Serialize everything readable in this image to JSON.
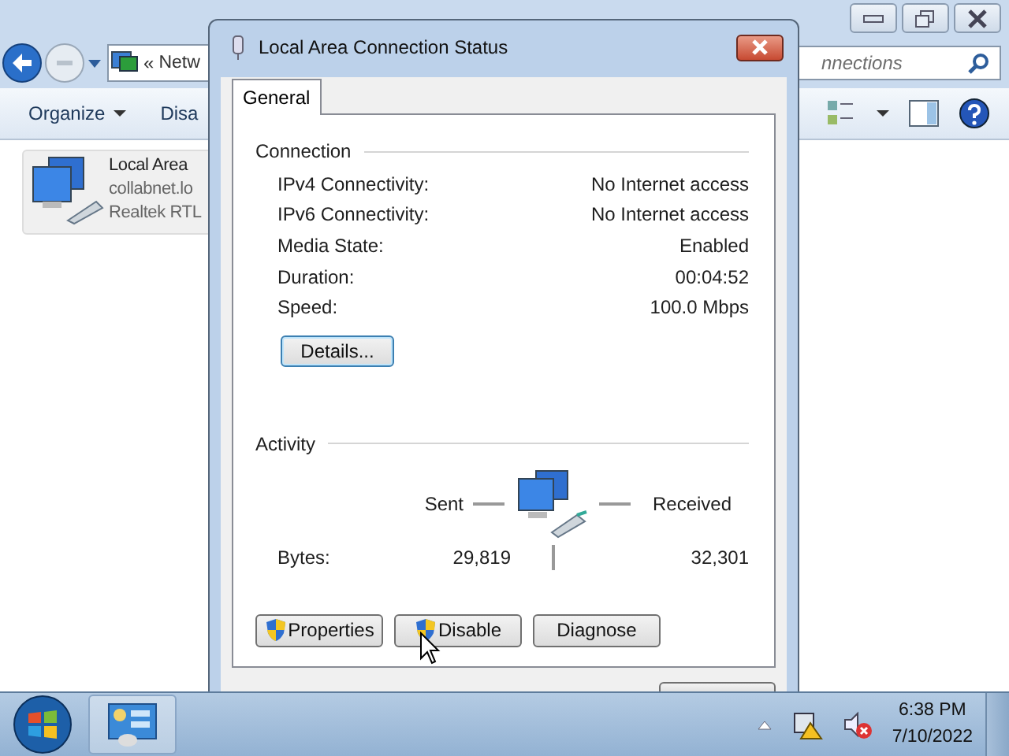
{
  "explorer": {
    "address": {
      "prefix": "«",
      "text": "Netw"
    },
    "search": {
      "placeholder": "nnections"
    },
    "toolbar": [
      {
        "label": "Organize",
        "dropdown": true
      },
      {
        "label": "Disa",
        "dropdown": false
      }
    ],
    "items": [
      {
        "lines": [
          "Local Area",
          "collabnet.lo",
          "Realtek RTL"
        ]
      }
    ]
  },
  "dialog": {
    "title": "Local Area Connection Status",
    "tabs": [
      {
        "label": "General",
        "selected": true
      }
    ],
    "connection": {
      "heading": "Connection",
      "rows": [
        {
          "label": "IPv4 Connectivity:",
          "value": "No Internet access"
        },
        {
          "label": "IPv6 Connectivity:",
          "value": "No Internet access"
        },
        {
          "label": "Media State:",
          "value": "Enabled"
        },
        {
          "label": "Duration:",
          "value": "00:04:52"
        },
        {
          "label": "Speed:",
          "value": "100.0 Mbps"
        }
      ],
      "details_button": "Details..."
    },
    "activity": {
      "heading": "Activity",
      "sent": "Sent",
      "received": "Received",
      "bytes_label": "Bytes:",
      "bytes_sent": "29,819",
      "bytes_received": "32,301"
    },
    "buttons": [
      {
        "label": "Properties",
        "shield": true
      },
      {
        "label": "Disable",
        "shield": true
      },
      {
        "label": "Diagnose",
        "shield": false
      }
    ]
  },
  "taskbar": {
    "time": "6:38 PM",
    "date": "7/10/2022"
  }
}
